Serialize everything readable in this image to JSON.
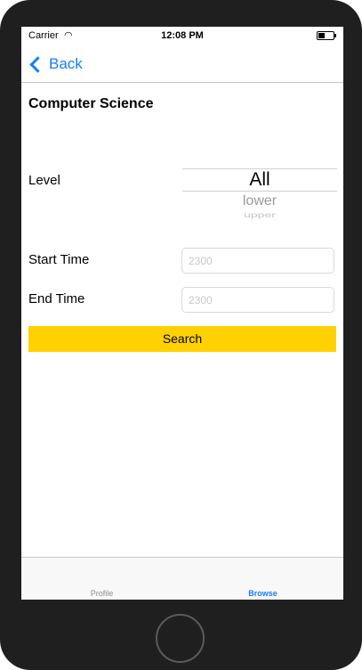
{
  "status_bar": {
    "carrier": "Carrier",
    "wifi_icon": "wifi-icon",
    "time": "12:08 PM",
    "battery_icon": "battery-icon"
  },
  "nav": {
    "back_icon": "chevron-left-icon",
    "back_label": "Back",
    "accent_color": "#157efb"
  },
  "page": {
    "title": "Computer Science"
  },
  "form": {
    "level_label": "Level",
    "level_picker": {
      "selected": "All",
      "options": [
        "lower",
        "upper"
      ]
    },
    "start_label": "Start Time",
    "start_placeholder": "2300",
    "start_value": "",
    "end_label": "End Time",
    "end_placeholder": "2300",
    "end_value": "",
    "search_label": "Search",
    "search_color": "#ffd100"
  },
  "tab_bar": {
    "tabs": [
      {
        "label": "Profile",
        "active": false
      },
      {
        "label": "Browse",
        "active": true
      }
    ]
  }
}
